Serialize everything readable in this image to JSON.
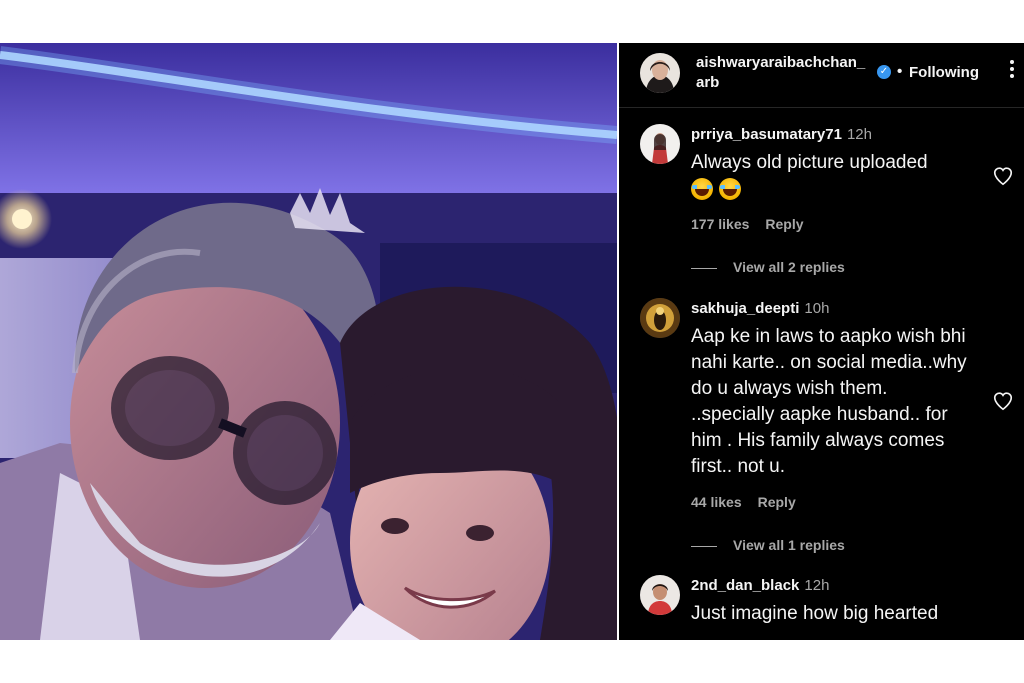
{
  "post": {
    "author": "aishwaryaraibachchan_arb",
    "follow_status": "Following",
    "separator": "•",
    "verified_icon": "verified-badge-icon",
    "more_icon": "more-options-icon"
  },
  "comments": [
    {
      "username": "prriya_basumatary71",
      "time": "12h",
      "text": "Always old picture uploaded",
      "emojis": [
        "😂",
        "😂"
      ],
      "likes": "177 likes",
      "reply_label": "Reply",
      "view_replies": "View all 2 replies"
    },
    {
      "username": "sakhuja_deepti",
      "time": "10h",
      "text": "Aap ke in laws to aapko wish bhi nahi karte.. on social media..why do u always wish them. ..specially aapke husband.. for him . His family always comes first.. not u.",
      "likes": "44 likes",
      "reply_label": "Reply",
      "view_replies": "View all 1 replies"
    },
    {
      "username": "2nd_dan_black",
      "time": "12h",
      "text": "Just imagine how big hearted"
    }
  ],
  "colors": {
    "panel_bg": "#000000",
    "text_primary": "#f5f5f5",
    "text_secondary": "#a8a8a8",
    "verified_blue": "#3897f0",
    "page_bg": "#ffffff"
  }
}
